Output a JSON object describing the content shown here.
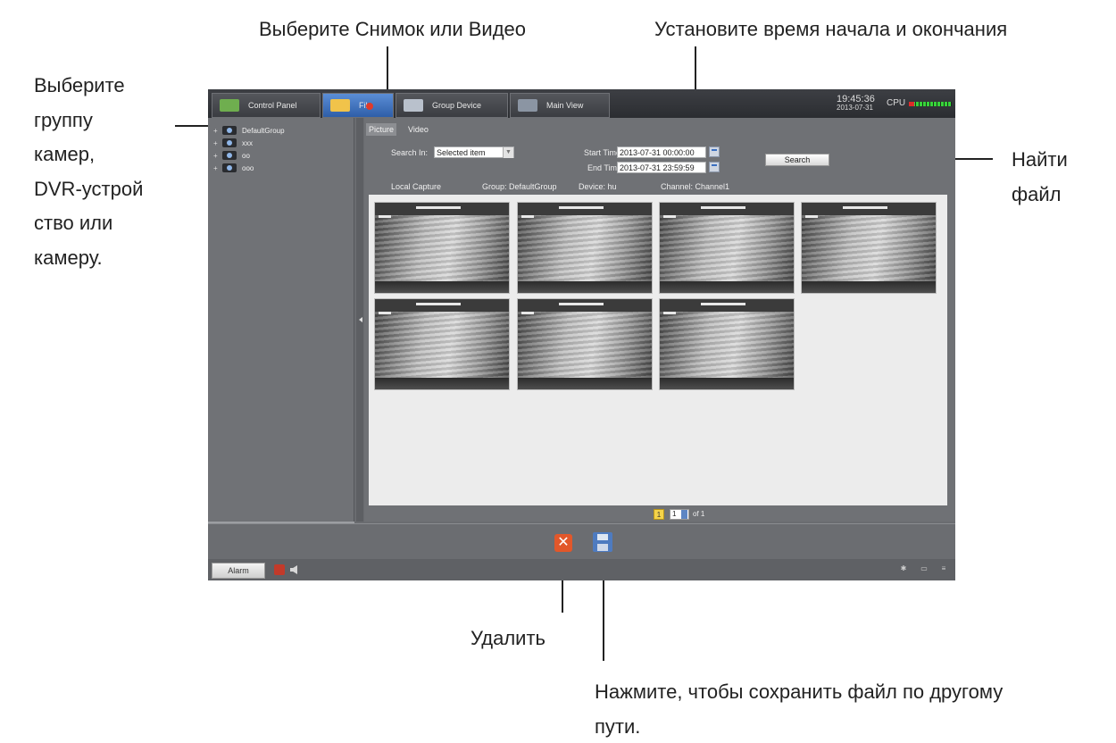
{
  "annotations": {
    "select_type": "Выберите Снимок или Видео",
    "set_time": "Установите время начала и окончания",
    "select_group_lines": [
      "Выберите",
      "группу",
      "камер,",
      "DVR-устрой",
      "ство или",
      "камеру."
    ],
    "find_file_lines": [
      "Найти",
      "файл"
    ],
    "delete": "Удалить",
    "save_lines": [
      "Нажмите, чтобы сохранить файл по другому",
      "пути."
    ]
  },
  "topbar": {
    "tabs": [
      {
        "label": "Control Panel",
        "icon": "monitor-icon"
      },
      {
        "label": "File",
        "icon": "folder-icon"
      },
      {
        "label": "Group Device",
        "icon": "device-icon"
      },
      {
        "label": "Main View",
        "icon": "view-icon"
      }
    ],
    "time": "19:45:36",
    "date": "2013-07-31",
    "cpu_label": "CPU"
  },
  "sidebar": {
    "items": [
      {
        "label": "DefaultGroup"
      },
      {
        "label": "xxx"
      },
      {
        "label": "oo"
      },
      {
        "label": "ooo"
      }
    ]
  },
  "main": {
    "subtabs": [
      "Picture",
      "Video"
    ],
    "search_in_label": "Search In:",
    "search_in_value": "Selected item",
    "start_label": "Start Time:",
    "start_value": "2013-07-31 00:00:00",
    "end_label": "End Time:",
    "end_value": "2013-07-31 23:59:59",
    "search_button": "Search",
    "info": {
      "local_capture": "Local Capture",
      "group": "Group: DefaultGroup",
      "device": "Device: hu",
      "channel": "Channel: Channel1"
    },
    "pager": {
      "current": "1",
      "input": "1",
      "of": "of 1"
    }
  },
  "statusbar": {
    "alarm_tab": "Alarm"
  },
  "colors": {
    "accent": "#3a6fc1",
    "delete": "#e2572a",
    "cpu_green": "#37d43a"
  }
}
